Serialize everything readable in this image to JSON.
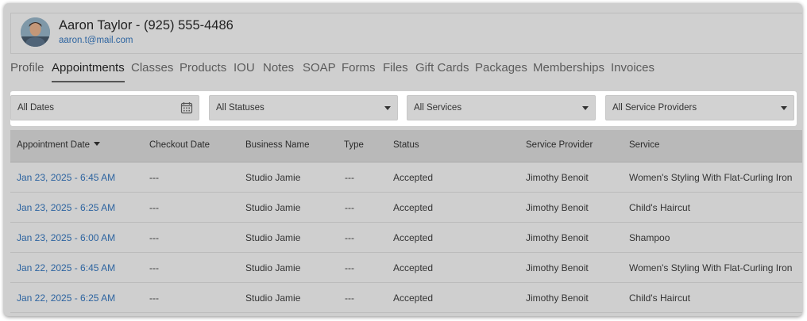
{
  "client": {
    "name": "Aaron Taylor - (925) 555-4486",
    "email": "aaron.t@mail.com"
  },
  "tabs": [
    {
      "label": "Profile"
    },
    {
      "label": "Appointments",
      "active": true
    },
    {
      "label": "Classes"
    },
    {
      "label": "Products"
    },
    {
      "label": "IOU"
    },
    {
      "label": "Notes"
    },
    {
      "label": "SOAP"
    },
    {
      "label": "Forms"
    },
    {
      "label": "Files"
    },
    {
      "label": "Gift Cards"
    },
    {
      "label": "Packages"
    },
    {
      "label": "Memberships"
    },
    {
      "label": "Invoices"
    }
  ],
  "filters": {
    "dates": "All Dates",
    "statuses": "All Statuses",
    "services": "All Services",
    "providers": "All Service Providers"
  },
  "table": {
    "headers": [
      "Appointment Date",
      "Checkout Date",
      "Business Name",
      "Type",
      "Status",
      "Service Provider",
      "Service"
    ],
    "rows": [
      [
        "Jan 23, 2025 - 6:45 AM",
        "---",
        "Studio Jamie",
        "---",
        "Accepted",
        "Jimothy Benoit",
        "Women's Styling With Flat-Curling Iron"
      ],
      [
        "Jan 23, 2025 - 6:25 AM",
        "---",
        "Studio Jamie",
        "---",
        "Accepted",
        "Jimothy Benoit",
        "Child's Haircut"
      ],
      [
        "Jan 23, 2025 - 6:00 AM",
        "---",
        "Studio Jamie",
        "---",
        "Accepted",
        "Jimothy Benoit",
        "Shampoo"
      ],
      [
        "Jan 22, 2025 - 6:45 AM",
        "---",
        "Studio Jamie",
        "---",
        "Accepted",
        "Jimothy Benoit",
        "Women's Styling With Flat-Curling Iron"
      ],
      [
        "Jan 22, 2025 - 6:25 AM",
        "---",
        "Studio Jamie",
        "---",
        "Accepted",
        "Jimothy Benoit",
        "Child's Haircut"
      ]
    ]
  },
  "colors": {
    "link": "#2d64a0",
    "overlay": "#cfcfcf",
    "header_bg": "#b9b9b9"
  }
}
